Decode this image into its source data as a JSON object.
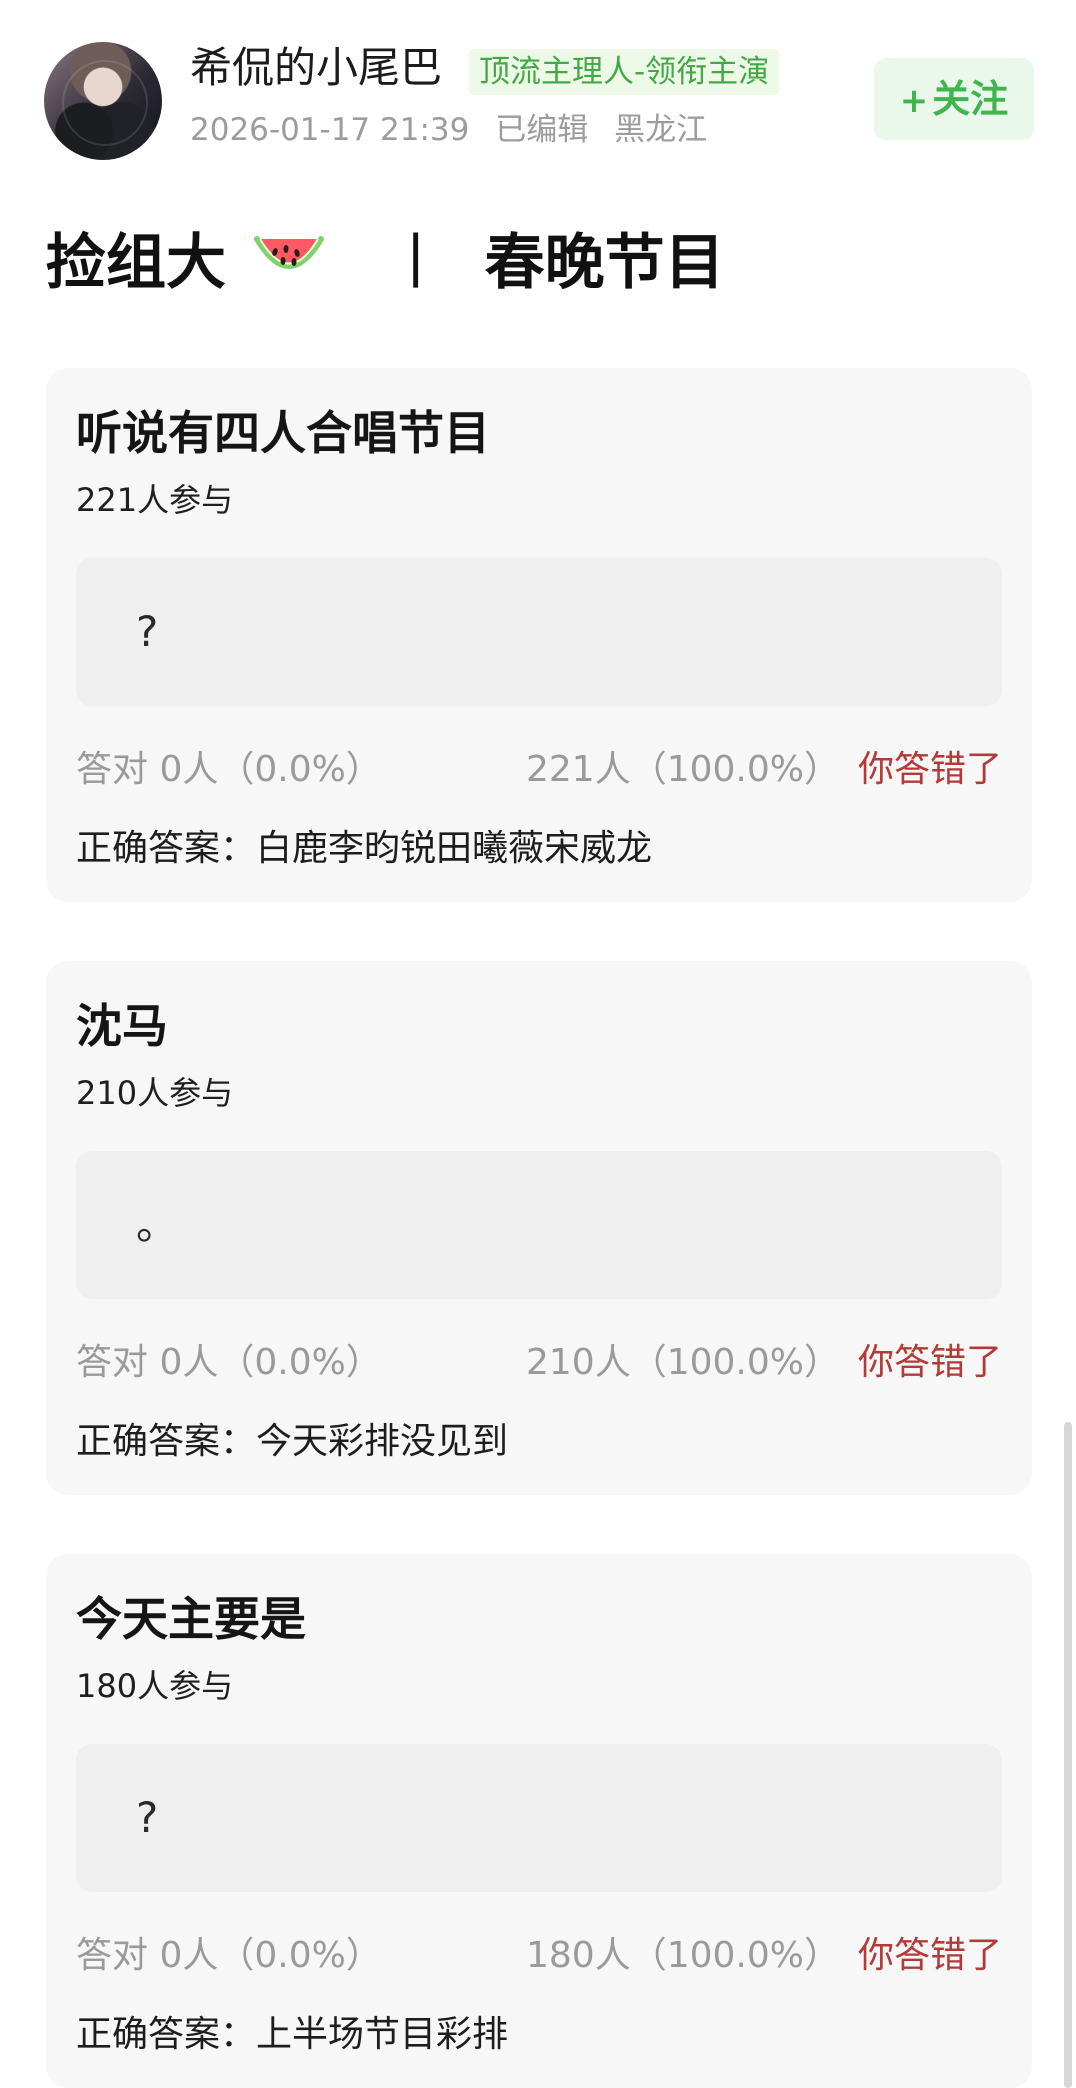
{
  "post": {
    "author": {
      "name": "希侃的小尾巴",
      "badge": "顶流主理人-领衔主演",
      "timestamp": "2026-01-17 21:39",
      "edited": "已编辑",
      "location": "黑龙江",
      "avatar_icon": "avatar"
    },
    "follow": {
      "icon": "+",
      "label": "关注"
    },
    "title": {
      "left": "捡组大",
      "separator": "丨",
      "right": "春晚节目",
      "emoji": "watermelon"
    }
  },
  "quizzes": [
    {
      "question": "听说有四人合唱节目",
      "participants": "221人参与",
      "answer_text": "?",
      "correct_summary": "答对 0人（0.0%）",
      "wrong_summary": "221人（100.0%）",
      "status": "你答错了",
      "correct_answer": "正确答案：白鹿李昀锐田曦薇宋威龙"
    },
    {
      "question": "沈马",
      "participants": "210人参与",
      "answer_text": "。",
      "correct_summary": "答对 0人（0.0%）",
      "wrong_summary": "210人（100.0%）",
      "status": "你答错了",
      "correct_answer": "正确答案：今天彩排没见到"
    },
    {
      "question": "今天主要是",
      "participants": "180人参与",
      "answer_text": "?",
      "correct_summary": "答对 0人（0.0%）",
      "wrong_summary": "180人（100.0%）",
      "status": "你答错了",
      "correct_answer": "正确答案：上半场节目彩排"
    }
  ],
  "colors": {
    "accent_green": "#3fb64d",
    "badge_green_bg": "#eef8e6",
    "wrong_red": "#b33a37",
    "card_bg": "#f7f7f7"
  }
}
